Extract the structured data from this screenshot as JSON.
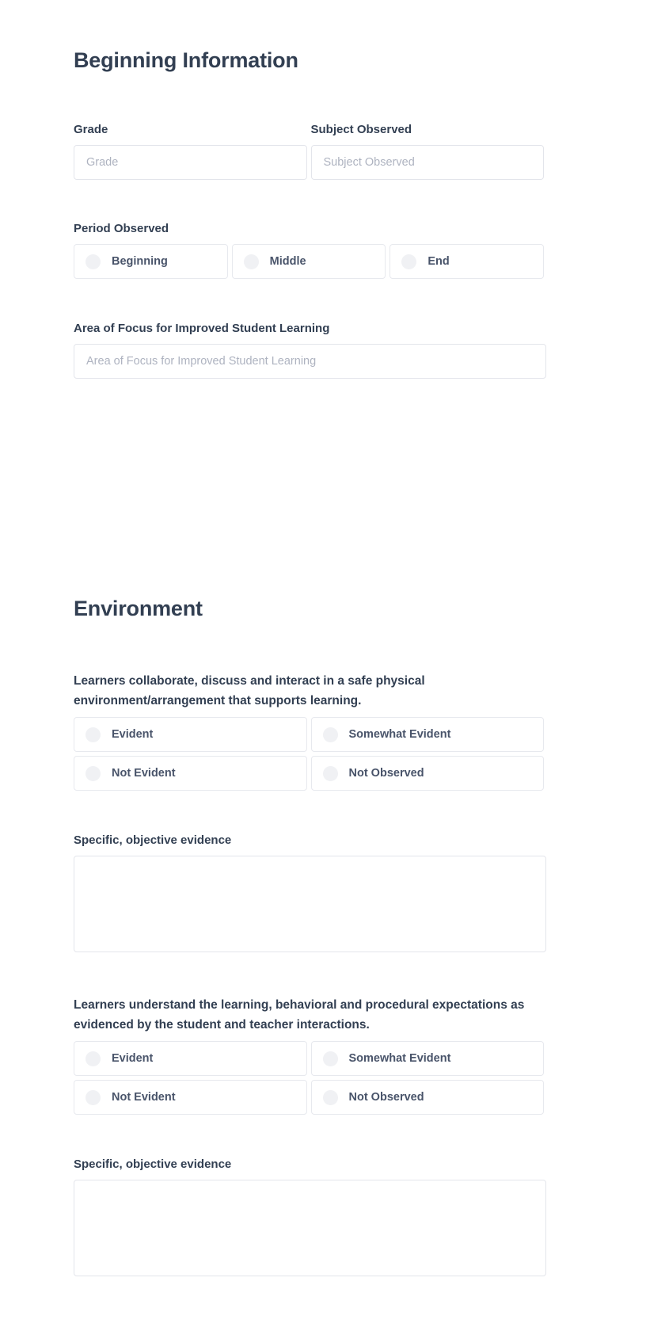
{
  "sections": [
    {
      "id": "beginning-information",
      "title": "Beginning Information",
      "fields": {
        "grade": {
          "label": "Grade",
          "placeholder": "Grade",
          "value": ""
        },
        "subject": {
          "label": "Subject Observed",
          "placeholder": "Subject Observed",
          "value": ""
        },
        "period": {
          "label": "Period Observed",
          "options": [
            "Beginning",
            "Middle",
            "End"
          ],
          "selected": null
        },
        "focus": {
          "label": "Area of Focus for Improved Student Learning",
          "placeholder": "Area of Focus for Improved Student Learning",
          "value": ""
        }
      }
    },
    {
      "id": "environment",
      "title": "Environment",
      "questions": [
        {
          "prompt": "Learners collaborate, discuss and interact in a safe physical environment/arrangement that supports learning.",
          "options": [
            "Evident",
            "Somewhat Evident",
            "Not Evident",
            "Not Observed"
          ],
          "selected": null,
          "evidence_label": "Specific, objective evidence",
          "evidence_placeholder": "",
          "evidence_value": ""
        },
        {
          "prompt": "Learners understand the learning, behavioral and procedural expectations as evidenced by the student and teacher interactions.",
          "options": [
            "Evident",
            "Somewhat Evident",
            "Not Evident",
            "Not Observed"
          ],
          "selected": null,
          "evidence_label": "Specific, objective evidence",
          "evidence_placeholder": "",
          "evidence_value": ""
        }
      ]
    }
  ],
  "colors": {
    "heading": "#323f52",
    "body_text": "#49546a",
    "placeholder": "#aeb3c0",
    "border": "#e3e5eb",
    "radio_fill": "#f0f1f4",
    "background": "#ffffff"
  }
}
